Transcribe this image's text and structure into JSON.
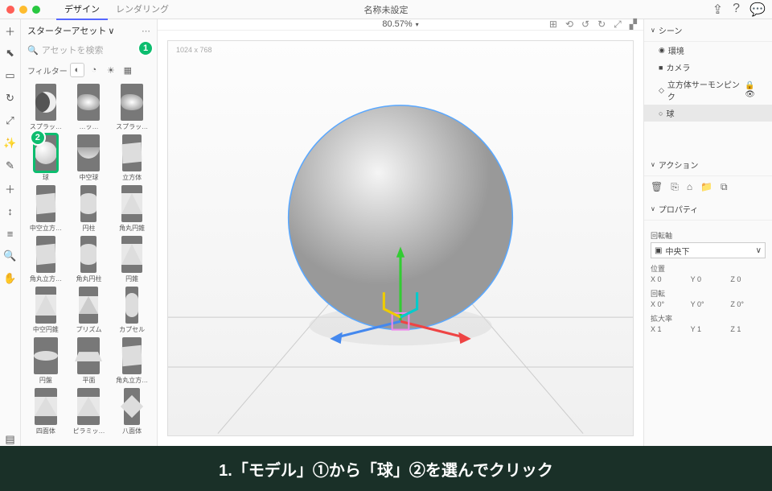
{
  "titlebar": {
    "tabs": [
      "デザイン",
      "レンダリング"
    ],
    "active_tab": 0,
    "title": "名称未設定"
  },
  "sidebar": {
    "header": "スターターアセット",
    "search_placeholder": "アセットを検索",
    "filter_label": "フィルター",
    "assets": [
      {
        "label": "スプラッ…",
        "shape": "s-moon"
      },
      {
        "label": "…ッ…",
        "shape": "s-splash"
      },
      {
        "label": "スプラッ…",
        "shape": "s-splash"
      },
      {
        "label": "球",
        "shape": "s-sphere",
        "selected": true
      },
      {
        "label": "中空球",
        "shape": "s-hemi"
      },
      {
        "label": "立方体",
        "shape": "s-cube"
      },
      {
        "label": "中空立方…",
        "shape": "s-cube"
      },
      {
        "label": "円柱",
        "shape": "s-cyl"
      },
      {
        "label": "角丸円錐",
        "shape": "s-cone"
      },
      {
        "label": "角丸立方…",
        "shape": "s-cube"
      },
      {
        "label": "角丸円柱",
        "shape": "s-cyl"
      },
      {
        "label": "円錐",
        "shape": "s-cone"
      },
      {
        "label": "中空円錐",
        "shape": "s-cone"
      },
      {
        "label": "プリズム",
        "shape": "s-prism"
      },
      {
        "label": "カプセル",
        "shape": "s-pill"
      },
      {
        "label": "円盤",
        "shape": "s-disc"
      },
      {
        "label": "平面",
        "shape": "s-plane"
      },
      {
        "label": "角丸立方…",
        "shape": "s-cube"
      },
      {
        "label": "四面体",
        "shape": "s-tetra"
      },
      {
        "label": "ピラミッ…",
        "shape": "s-tetra"
      },
      {
        "label": "八面体",
        "shape": "s-oct"
      }
    ]
  },
  "viewport": {
    "zoom": "80.57%",
    "canvas_dim": "1024 x 768"
  },
  "right": {
    "scene_header": "シーン",
    "scene_items": [
      {
        "icon": "◉",
        "label": "環境"
      },
      {
        "icon": "■",
        "label": "カメラ"
      },
      {
        "icon": "◇",
        "label": "立方体サーモンピンク",
        "locked": true
      },
      {
        "icon": "○",
        "label": "球",
        "selected": true
      }
    ],
    "actions_header": "アクション",
    "properties_header": "プロパティ",
    "pivot_label": "回転軸",
    "pivot_value": "中央下",
    "position_label": "位置",
    "position": {
      "x": "X 0",
      "y": "Y 0",
      "z": "Z 0"
    },
    "rotation_label": "回転",
    "rotation": {
      "x": "X 0°",
      "y": "Y 0°",
      "z": "Z 0°"
    },
    "scale_label": "拡大率",
    "scale": {
      "x": "X 1",
      "y": "Y 1",
      "z": "Z 1"
    }
  },
  "callouts": {
    "one": "1",
    "two": "2"
  },
  "instruction": "1.「モデル」①から「球」②を選んでクリック"
}
